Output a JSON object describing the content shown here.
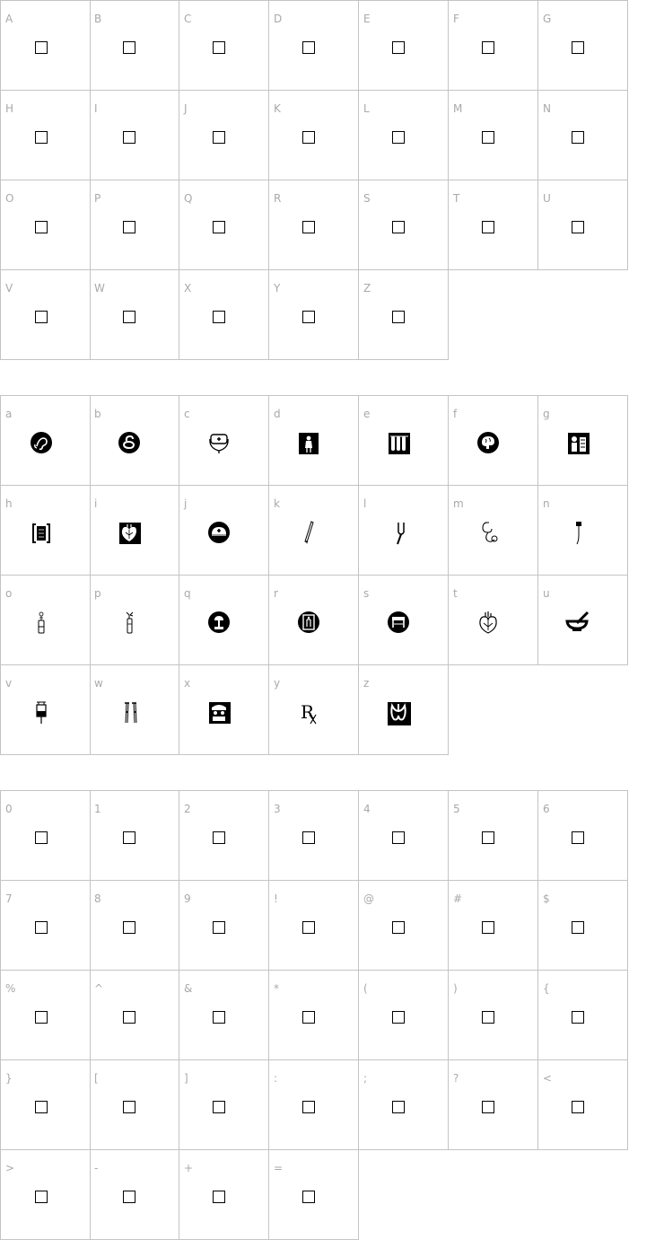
{
  "sections": [
    {
      "id": "uppercase",
      "cells": [
        {
          "label": "A",
          "glyph": "missing-glyph-box"
        },
        {
          "label": "B",
          "glyph": "missing-glyph-box"
        },
        {
          "label": "C",
          "glyph": "missing-glyph-box"
        },
        {
          "label": "D",
          "glyph": "missing-glyph-box"
        },
        {
          "label": "E",
          "glyph": "missing-glyph-box"
        },
        {
          "label": "F",
          "glyph": "missing-glyph-box"
        },
        {
          "label": "G",
          "glyph": "missing-glyph-box"
        },
        {
          "label": "H",
          "glyph": "missing-glyph-box"
        },
        {
          "label": "I",
          "glyph": "missing-glyph-box"
        },
        {
          "label": "J",
          "glyph": "missing-glyph-box"
        },
        {
          "label": "K",
          "glyph": "missing-glyph-box"
        },
        {
          "label": "L",
          "glyph": "missing-glyph-box"
        },
        {
          "label": "M",
          "glyph": "missing-glyph-box"
        },
        {
          "label": "N",
          "glyph": "missing-glyph-box"
        },
        {
          "label": "O",
          "glyph": "missing-glyph-box"
        },
        {
          "label": "P",
          "glyph": "missing-glyph-box"
        },
        {
          "label": "Q",
          "glyph": "missing-glyph-box"
        },
        {
          "label": "R",
          "glyph": "missing-glyph-box"
        },
        {
          "label": "S",
          "glyph": "missing-glyph-box"
        },
        {
          "label": "T",
          "glyph": "missing-glyph-box"
        },
        {
          "label": "U",
          "glyph": "missing-glyph-box"
        },
        {
          "label": "V",
          "glyph": "missing-glyph-box"
        },
        {
          "label": "W",
          "glyph": "missing-glyph-box"
        },
        {
          "label": "X",
          "glyph": "missing-glyph-box"
        },
        {
          "label": "Y",
          "glyph": "missing-glyph-box"
        },
        {
          "label": "Z",
          "glyph": "missing-glyph-box"
        }
      ]
    },
    {
      "id": "lowercase",
      "cells": [
        {
          "label": "a",
          "glyph": "ear-circle-icon"
        },
        {
          "label": "b",
          "glyph": "intestine-circle-icon"
        },
        {
          "label": "c",
          "glyph": "stethoscope-kit-icon"
        },
        {
          "label": "d",
          "glyph": "nurse-square-icon"
        },
        {
          "label": "e",
          "glyph": "test-tubes-icon"
        },
        {
          "label": "f",
          "glyph": "brain-circle-icon"
        },
        {
          "label": "g",
          "glyph": "anatomy-square-icon"
        },
        {
          "label": "h",
          "glyph": "xray-frame-icon"
        },
        {
          "label": "i",
          "glyph": "heart-square-icon"
        },
        {
          "label": "j",
          "glyph": "nurse-cap-icon"
        },
        {
          "label": "k",
          "glyph": "thermometer-icon"
        },
        {
          "label": "l",
          "glyph": "tuning-fork-icon"
        },
        {
          "label": "m",
          "glyph": "stethoscope-icon"
        },
        {
          "label": "n",
          "glyph": "reflex-hammer-icon"
        },
        {
          "label": "o",
          "glyph": "vial-icon"
        },
        {
          "label": "p",
          "glyph": "swab-tube-icon"
        },
        {
          "label": "q",
          "glyph": "microscope-circle-icon"
        },
        {
          "label": "r",
          "glyph": "doorway-circle-icon"
        },
        {
          "label": "s",
          "glyph": "bed-circle-icon"
        },
        {
          "label": "t",
          "glyph": "heart-icon"
        },
        {
          "label": "u",
          "glyph": "mortar-pestle-icon"
        },
        {
          "label": "v",
          "glyph": "iv-bag-icon"
        },
        {
          "label": "w",
          "glyph": "crutches-icon"
        },
        {
          "label": "x",
          "glyph": "surgeon-face-icon"
        },
        {
          "label": "y",
          "glyph": "rx-symbol-icon"
        },
        {
          "label": "z",
          "glyph": "lungs-square-icon"
        }
      ]
    },
    {
      "id": "symbols",
      "cells": [
        {
          "label": "0",
          "glyph": "missing-glyph-box"
        },
        {
          "label": "1",
          "glyph": "missing-glyph-box"
        },
        {
          "label": "2",
          "glyph": "missing-glyph-box"
        },
        {
          "label": "3",
          "glyph": "missing-glyph-box"
        },
        {
          "label": "4",
          "glyph": "missing-glyph-box"
        },
        {
          "label": "5",
          "glyph": "missing-glyph-box"
        },
        {
          "label": "6",
          "glyph": "missing-glyph-box"
        },
        {
          "label": "7",
          "glyph": "missing-glyph-box"
        },
        {
          "label": "8",
          "glyph": "missing-glyph-box"
        },
        {
          "label": "9",
          "glyph": "missing-glyph-box"
        },
        {
          "label": "!",
          "glyph": "missing-glyph-box"
        },
        {
          "label": "@",
          "glyph": "missing-glyph-box"
        },
        {
          "label": "#",
          "glyph": "missing-glyph-box"
        },
        {
          "label": "$",
          "glyph": "missing-glyph-box"
        },
        {
          "label": "%",
          "glyph": "missing-glyph-box"
        },
        {
          "label": "^",
          "glyph": "missing-glyph-box"
        },
        {
          "label": "&",
          "glyph": "missing-glyph-box"
        },
        {
          "label": "*",
          "glyph": "missing-glyph-box"
        },
        {
          "label": "(",
          "glyph": "missing-glyph-box"
        },
        {
          "label": ")",
          "glyph": "missing-glyph-box"
        },
        {
          "label": "{",
          "glyph": "missing-glyph-box"
        },
        {
          "label": "}",
          "glyph": "missing-glyph-box"
        },
        {
          "label": "[",
          "glyph": "missing-glyph-box"
        },
        {
          "label": "]",
          "glyph": "missing-glyph-box"
        },
        {
          "label": ":",
          "glyph": "missing-glyph-box"
        },
        {
          "label": ";",
          "glyph": "missing-glyph-box"
        },
        {
          "label": "?",
          "glyph": "missing-glyph-box"
        },
        {
          "label": "<",
          "glyph": "missing-glyph-box"
        },
        {
          "label": ">",
          "glyph": "missing-glyph-box"
        },
        {
          "label": "-",
          "glyph": "missing-glyph-box"
        },
        {
          "label": "+",
          "glyph": "missing-glyph-box"
        },
        {
          "label": "=",
          "glyph": "missing-glyph-box"
        }
      ]
    }
  ],
  "colors": {
    "grid_line": "#c4c4c4",
    "label": "#a9a9a9",
    "glyph": "#000000"
  }
}
